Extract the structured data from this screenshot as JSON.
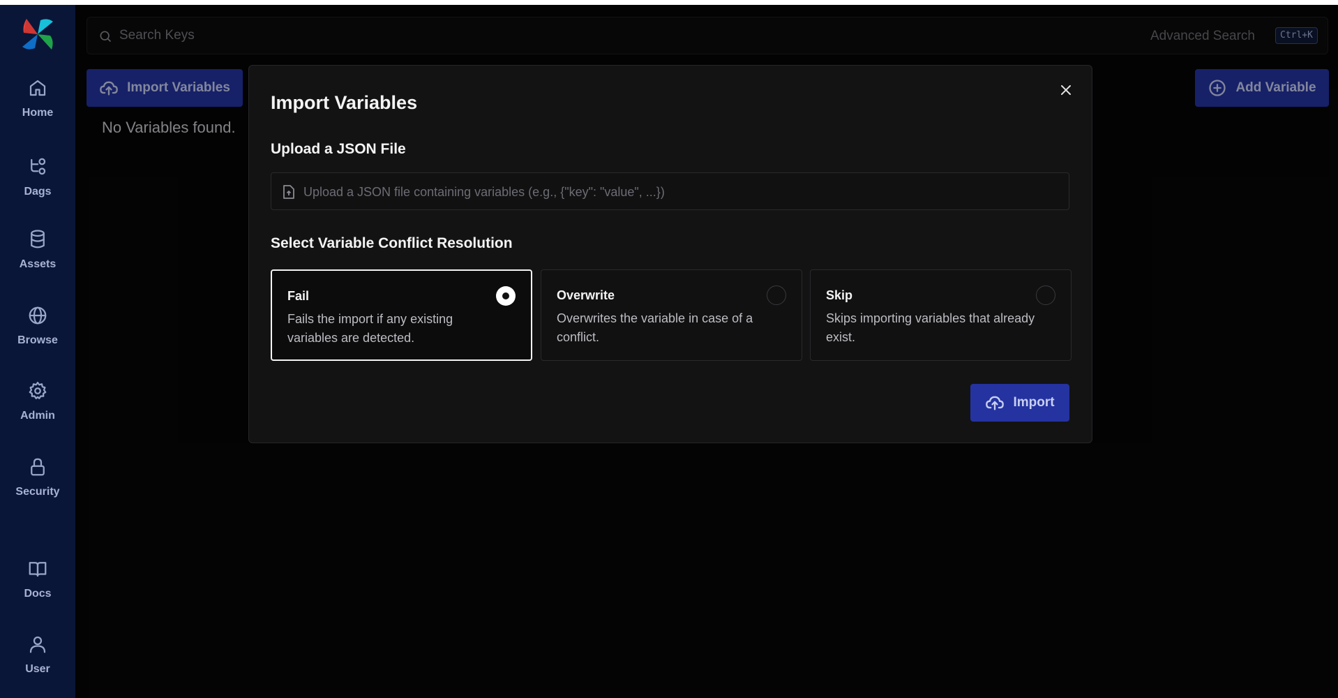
{
  "sidebar": {
    "items": [
      {
        "label": "Home",
        "icon": "home-icon"
      },
      {
        "label": "Dags",
        "icon": "dags-icon"
      },
      {
        "label": "Assets",
        "icon": "database-icon"
      },
      {
        "label": "Browse",
        "icon": "globe-icon"
      },
      {
        "label": "Admin",
        "icon": "gear-icon"
      },
      {
        "label": "Security",
        "icon": "lock-icon"
      },
      {
        "label": "Docs",
        "icon": "book-icon"
      },
      {
        "label": "User",
        "icon": "user-icon"
      }
    ]
  },
  "search": {
    "placeholder": "Search Keys",
    "value": "",
    "advanced_label": "Advanced Search",
    "shortcut": "Ctrl+K"
  },
  "toolbar": {
    "import_label": "Import Variables",
    "add_label": "Add Variable"
  },
  "main": {
    "empty_message": "No Variables found."
  },
  "modal": {
    "title": "Import Variables",
    "upload_heading": "Upload a JSON File",
    "upload_placeholder": "Upload a JSON file containing variables (e.g., {\"key\": \"value\", ...})",
    "conflict_heading": "Select Variable Conflict Resolution",
    "options": [
      {
        "title": "Fail",
        "description": "Fails the import if any existing variables are detected.",
        "selected": true
      },
      {
        "title": "Overwrite",
        "description": "Overwrites the variable in case of a conflict.",
        "selected": false
      },
      {
        "title": "Skip",
        "description": "Skips importing variables that already exist.",
        "selected": false
      }
    ],
    "import_button": "Import"
  },
  "colors": {
    "sidebar_bg": "#0a1638",
    "primary_button": "#2433a0",
    "background": "#060606",
    "modal_bg": "#131313"
  }
}
